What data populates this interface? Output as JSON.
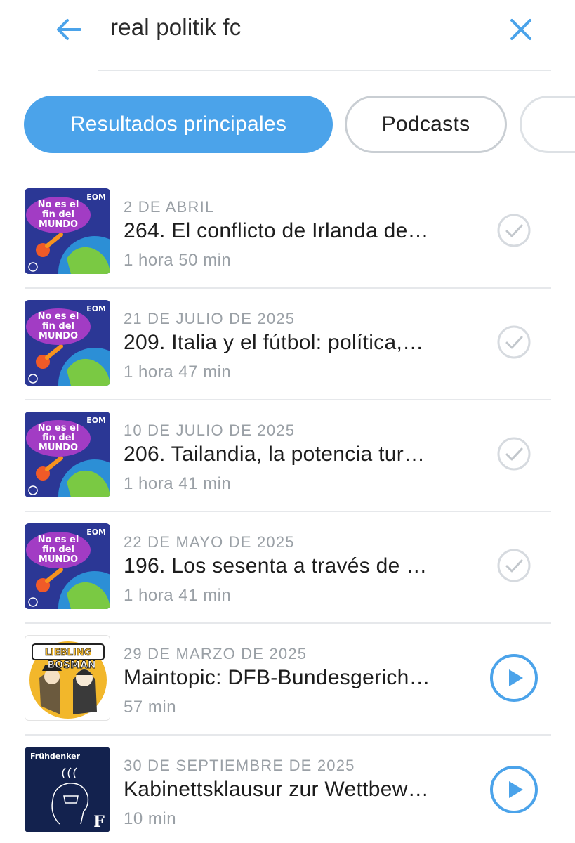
{
  "search": {
    "query": "real politik fc",
    "back_icon": "arrow-left-icon",
    "clear_icon": "close-icon",
    "accent_color": "#4ba3ea"
  },
  "filters": [
    {
      "label": "Resultados principales",
      "active": true
    },
    {
      "label": "Podcasts",
      "active": false
    },
    {
      "label": "",
      "active": false
    }
  ],
  "results": [
    {
      "date": "2 DE ABRIL",
      "title": "264. El conflicto de Irlanda de…",
      "duration": "1 hora 50 min",
      "artwork": "no-es-el-fin-del-mundo",
      "art_badge": "EOM",
      "art_text": [
        "No es el",
        "fin del",
        "MUNDO"
      ],
      "status": "played",
      "status_icon": "check-circle-icon"
    },
    {
      "date": "21 DE JULIO DE 2025",
      "title": "209. Italia y el fútbol: política,…",
      "duration": "1 hora 47 min",
      "artwork": "no-es-el-fin-del-mundo",
      "art_badge": "EOM",
      "art_text": [
        "No es el",
        "fin del",
        "MUNDO"
      ],
      "status": "played",
      "status_icon": "check-circle-icon"
    },
    {
      "date": "10 DE JULIO DE 2025",
      "title": "206. Tailandia, la potencia tur…",
      "duration": "1 hora 41 min",
      "artwork": "no-es-el-fin-del-mundo",
      "art_badge": "EOM",
      "art_text": [
        "No es el",
        "fin del",
        "MUNDO"
      ],
      "status": "played",
      "status_icon": "check-circle-icon"
    },
    {
      "date": "22 DE MAYO DE 2025",
      "title": "196. Los sesenta a través de …",
      "duration": "1 hora 41 min",
      "artwork": "no-es-el-fin-del-mundo",
      "art_badge": "EOM",
      "art_text": [
        "No es el",
        "fin del",
        "MUNDO"
      ],
      "status": "played",
      "status_icon": "check-circle-icon"
    },
    {
      "date": "29 DE MARZO DE 2025",
      "title": "Maintopic: DFB-Bundesgerich…",
      "duration": "57 min",
      "artwork": "liebling-bosman",
      "art_text": [
        "LIEBLING",
        "BOSMAN"
      ],
      "status": "unplayed",
      "status_icon": "play-circle-icon"
    },
    {
      "date": "30 DE SEPTIEMBRE DE 2025",
      "title": "Kabinettsklausur zur Wettbew…",
      "duration": "10 min",
      "artwork": "fruehdenker",
      "art_text": [
        "Frühdenker",
        "F"
      ],
      "status": "unplayed",
      "status_icon": "play-circle-icon"
    }
  ]
}
